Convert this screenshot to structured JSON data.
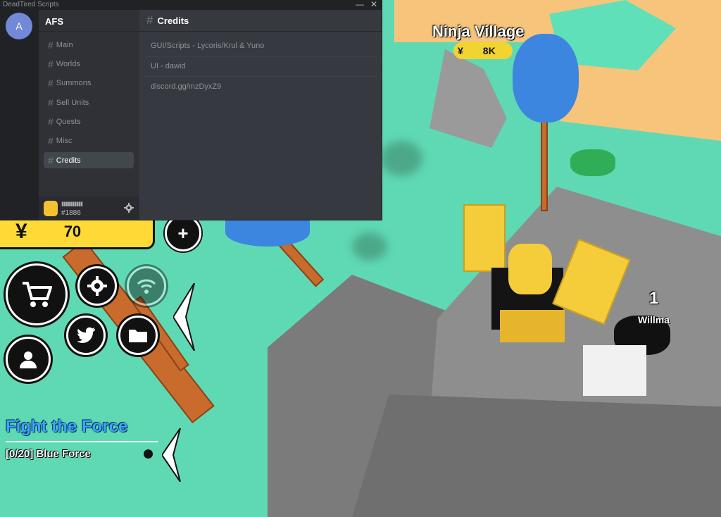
{
  "window": {
    "title": "DeadTired Scripts",
    "minimize_glyph": "—",
    "close_glyph": "✕"
  },
  "server": {
    "icon_letter": "A",
    "name": "AFS"
  },
  "channels": [
    {
      "label": "Main"
    },
    {
      "label": "Worlds"
    },
    {
      "label": "Summons"
    },
    {
      "label": "Sell Units"
    },
    {
      "label": "Quests"
    },
    {
      "label": "Misc"
    },
    {
      "label": "Credits"
    }
  ],
  "active_channel": "Credits",
  "user": {
    "name": "IIIIIIIIIIIIIIIIIIII",
    "tag": "#1886"
  },
  "content": {
    "header": "Credits",
    "messages": [
      "GUI/Scripts - Lycoris/Krul & Yuno",
      "UI - dawid",
      "discord.gg/mzDyxZ9"
    ]
  },
  "hud": {
    "currency_symbol": "¥",
    "currency_amount": "70",
    "plus_label": "+",
    "quest_title": "Fight the Force",
    "quest_item": "[0/20] Blue Force"
  },
  "world": {
    "village_name": "Ninja Village",
    "village_price_symbol": "¥",
    "village_price": "8K",
    "player_count": "1",
    "player_name": "Willma"
  },
  "colors": {
    "grass": "#5fd9b4",
    "sand": "#f6c47a",
    "discord_bg": "#36393f",
    "discord_sidebar": "#2f3136",
    "discord_rail": "#202225",
    "accent_blurple": "#7289da",
    "currency_yellow": "#ffd936",
    "quest_blue": "#36a8ff"
  }
}
